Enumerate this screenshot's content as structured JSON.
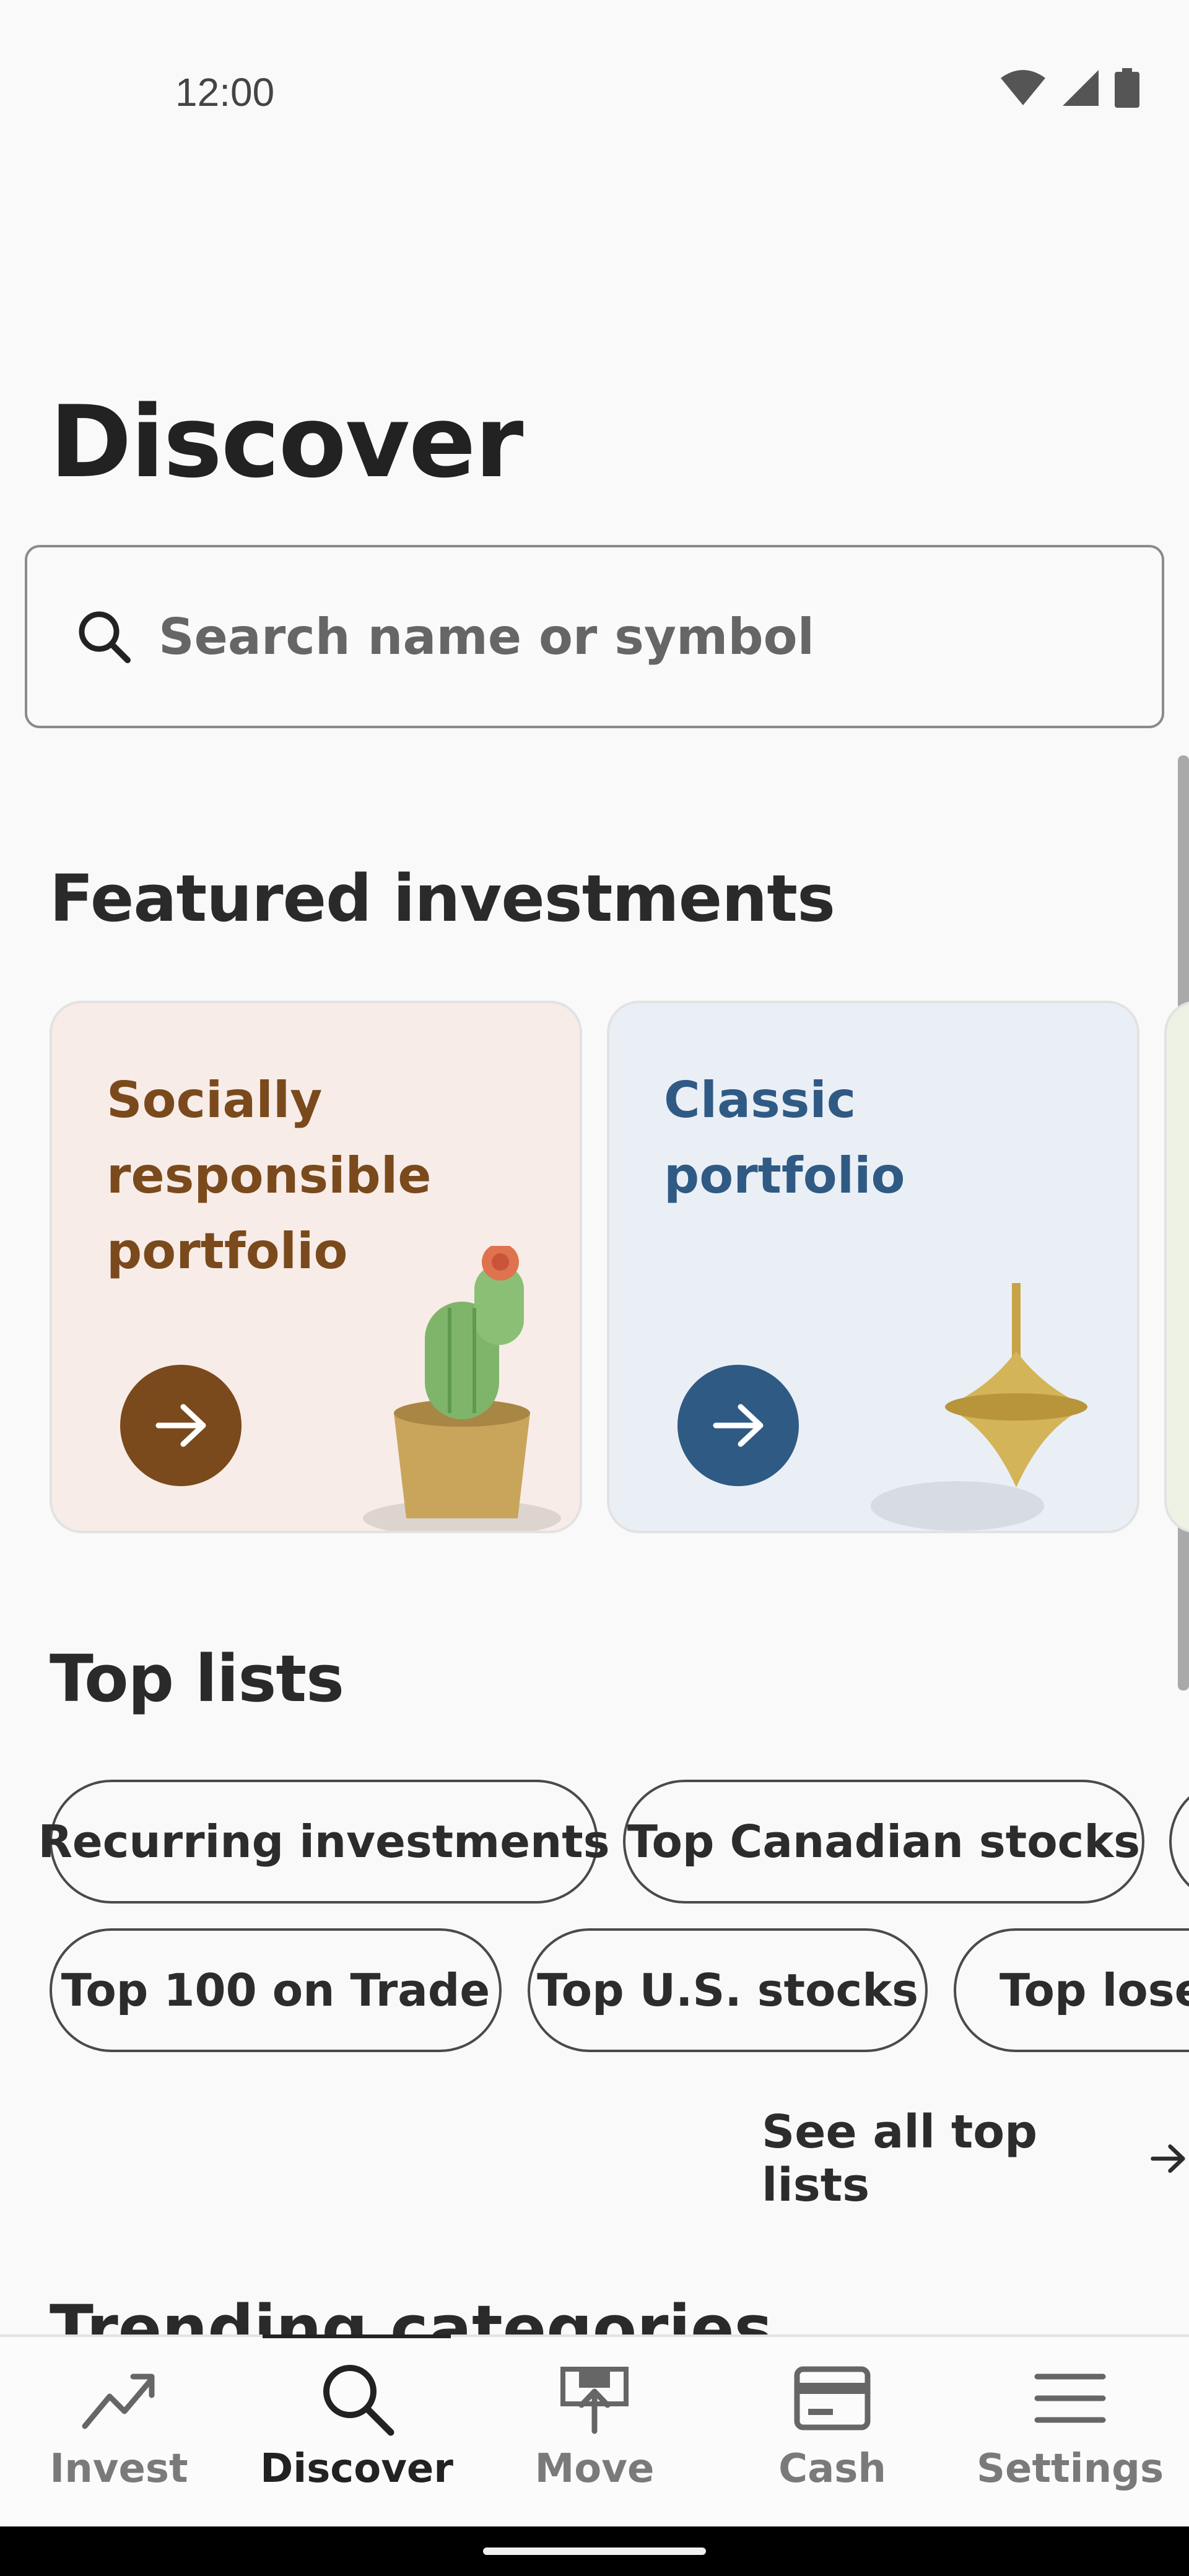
{
  "status": {
    "time": "12:00"
  },
  "header": {
    "title": "Discover"
  },
  "search": {
    "placeholder": "Search name or symbol"
  },
  "featured": {
    "title": "Featured investments",
    "cards": [
      {
        "label": "Socially responsible portfolio",
        "background": "#f8ece8",
        "text_color": "#7a4a1c",
        "button_color": "#7a4a1c"
      },
      {
        "label": "Classic portfolio",
        "background": "#eaeff6",
        "text_color": "#2f5a84",
        "button_color": "#2f5a84"
      }
    ]
  },
  "top_lists": {
    "title": "Top lists",
    "row1": [
      "Recurring investments",
      "Top Canadian stocks"
    ],
    "row2": [
      "Top 100 on Trade",
      "Top U.S. stocks",
      "Top loser"
    ],
    "see_all": "See all top lists"
  },
  "trending": {
    "title": "Trending categories"
  },
  "bottom_nav": {
    "items": [
      {
        "label": "Invest",
        "icon": "trending-up-icon"
      },
      {
        "label": "Discover",
        "icon": "search-icon",
        "active": true
      },
      {
        "label": "Move",
        "icon": "move-money-icon"
      },
      {
        "label": "Cash",
        "icon": "card-icon"
      },
      {
        "label": "Settings",
        "icon": "menu-icon"
      }
    ]
  }
}
